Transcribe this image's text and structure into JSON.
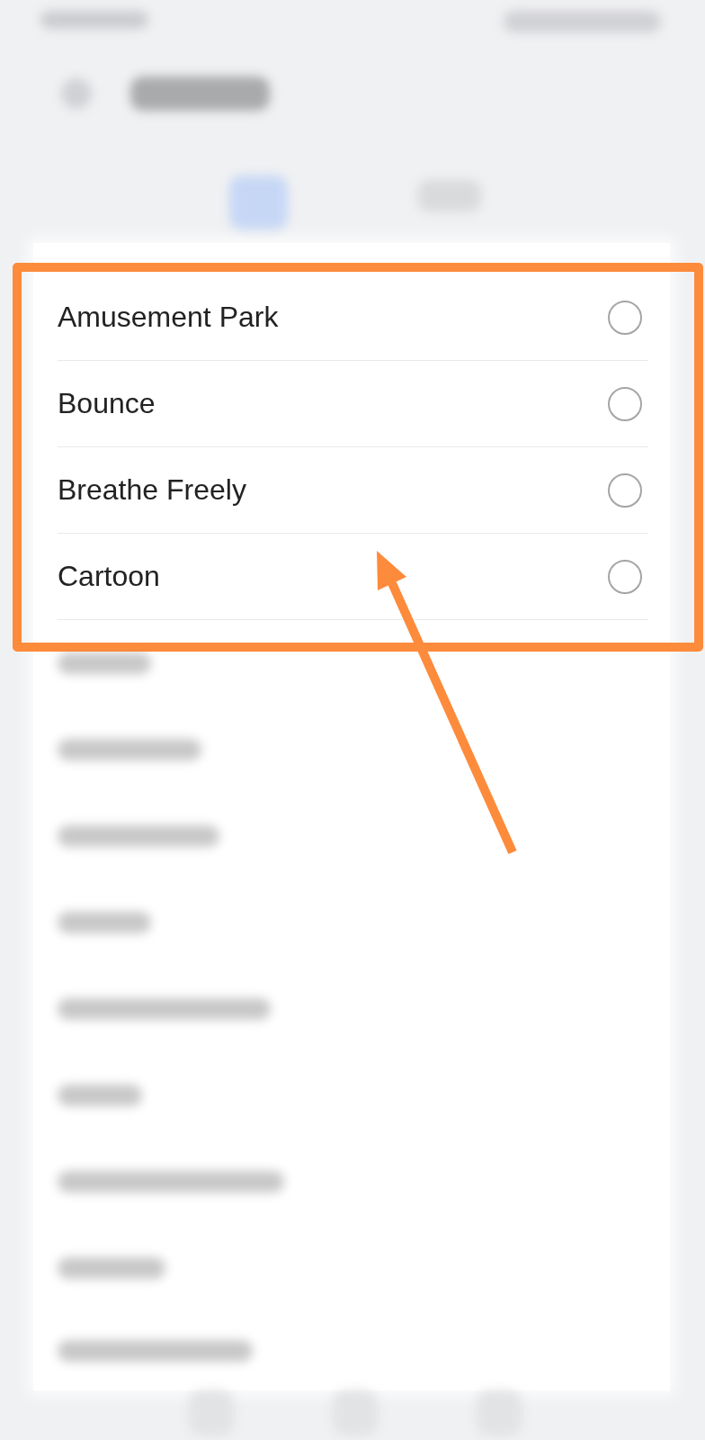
{
  "screen": {
    "blurred": true
  },
  "ringtones": [
    {
      "name": "Amusement Park",
      "selected": false
    },
    {
      "name": "Bounce",
      "selected": false
    },
    {
      "name": "Breathe Freely",
      "selected": false
    },
    {
      "name": "Cartoon",
      "selected": false
    }
  ],
  "callout": {
    "frame": true,
    "arrow": true
  }
}
